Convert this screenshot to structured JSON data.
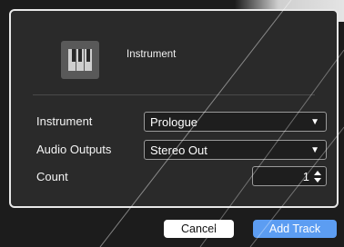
{
  "header": {
    "icon": "piano-keys-icon",
    "title": "Instrument"
  },
  "form": {
    "instrument": {
      "label": "Instrument",
      "value": "Prologue"
    },
    "audio_outputs": {
      "label": "Audio Outputs",
      "value": "Stereo Out"
    },
    "count": {
      "label": "Count",
      "value": "1"
    }
  },
  "buttons": {
    "cancel": "Cancel",
    "add_track": "Add Track"
  },
  "colors": {
    "dialog_bg": "#2a2a2a",
    "dialog_border": "#e8e8e8",
    "primary_button": "#5c9df2"
  }
}
